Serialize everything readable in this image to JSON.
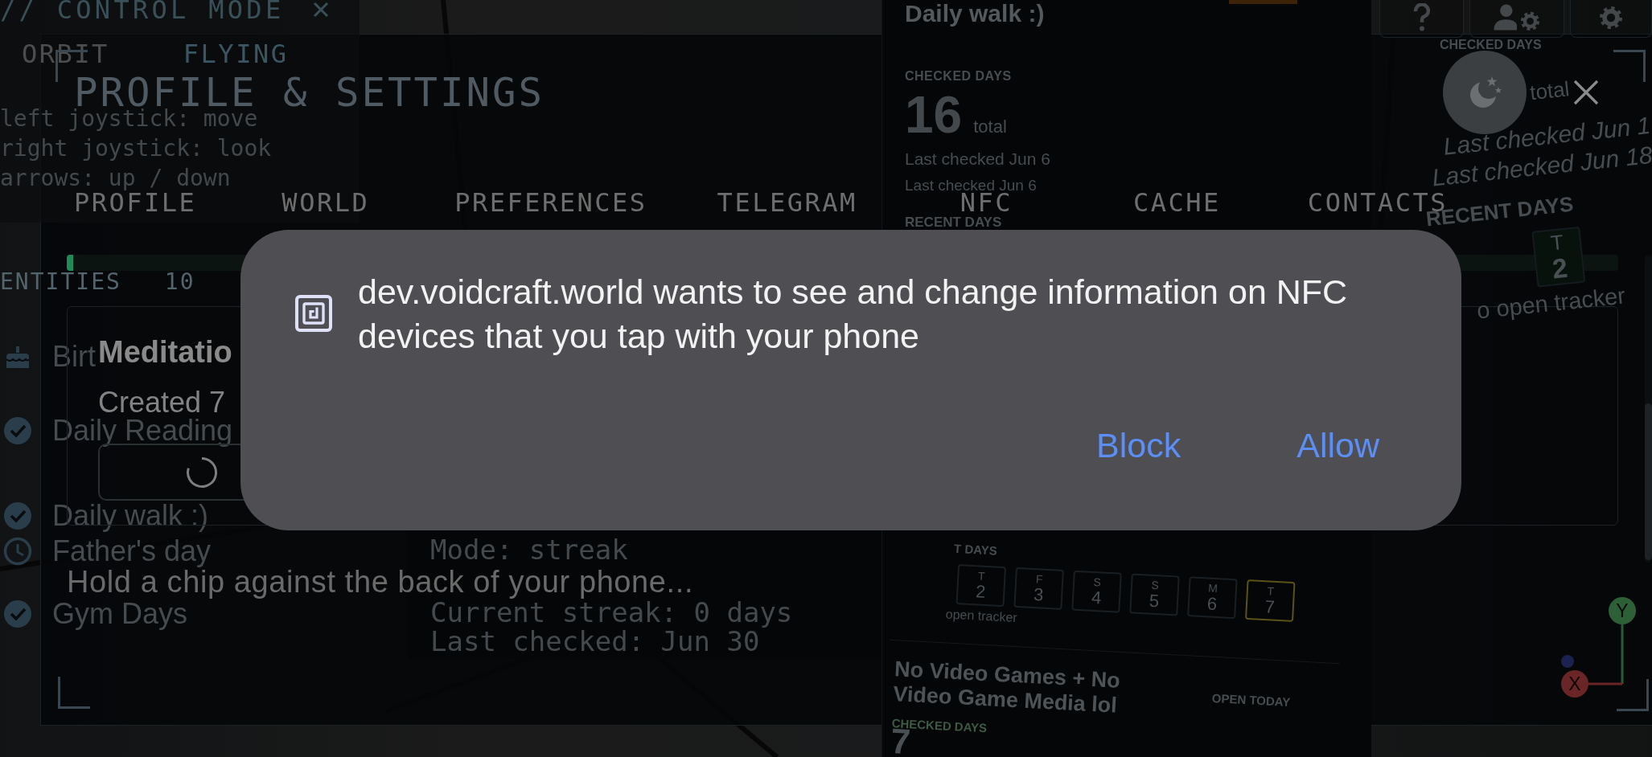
{
  "control_panel": {
    "title": "// CONTROL MODE",
    "modes": [
      {
        "label": "ORBIT",
        "selected": false
      },
      {
        "label": "FLYING",
        "selected": true
      }
    ],
    "hints": [
      "left joystick: move",
      "right joystick: look",
      "arrows: up / down"
    ],
    "entities_label": "ENTITIES",
    "entities_count": "10",
    "entities": [
      {
        "label": "Birt",
        "kind": "cake"
      },
      {
        "label": "Daily Reading",
        "kind": "check"
      },
      {
        "label": "Daily walk :)",
        "kind": "check"
      },
      {
        "label": "Father's day",
        "kind": "clock"
      },
      {
        "label": "Gym Days",
        "kind": "check"
      }
    ]
  },
  "walk_card": {
    "title": "Daily walk :)",
    "checked_label": "CHECKED DAYS",
    "count": "16",
    "count_unit": "total",
    "last_checked": [
      "Last checked Jun 6",
      "Last checked Jun 6"
    ],
    "recent_label": "RECENT DAYS"
  },
  "side_card": {
    "checked_label": "CHECKED DAYS",
    "count_unit": "total",
    "last_checked": [
      "Last checked Jun 1",
      "Last checked Jun 18"
    ],
    "recent_label": "RECENT DAYS",
    "day": {
      "weekday": "T",
      "date": "2"
    },
    "hint": "o open tracker"
  },
  "streak_card": {
    "lines": [
      "Mode: streak",
      "Current streak: 0 days",
      "Last checked: Jun 30"
    ]
  },
  "games_card": {
    "recent_label": "T DAYS",
    "days": [
      {
        "weekday": "T",
        "date": "2",
        "today": false
      },
      {
        "weekday": "F",
        "date": "3",
        "today": false
      },
      {
        "weekday": "S",
        "date": "4",
        "today": false
      },
      {
        "weekday": "S",
        "date": "5",
        "today": false
      },
      {
        "weekday": "M",
        "date": "6",
        "today": false
      },
      {
        "weekday": "T",
        "date": "7",
        "today": true
      }
    ],
    "hint": "open tracker",
    "title": "No Video Games + No Video Game Media lol",
    "action": "OPEN TODAY",
    "checked_label": "CHECKED DAYS",
    "count": "7"
  },
  "axis_gizmo": {
    "y_label": "Y",
    "x_label": "X"
  },
  "modal": {
    "title": "PROFILE & SETTINGS",
    "tabs": [
      "PROFILE",
      "WORLD",
      "PREFERENCES",
      "TELEGRAM",
      "NFC",
      "CACHE",
      "CONTACTS"
    ],
    "progress": {
      "level": 0.004
    },
    "entry": {
      "title": "Meditatio",
      "subtitle": "Created 7"
    },
    "status": "Hold a chip against the back of your phone..."
  },
  "nfc_dialog": {
    "message": "dev.voidcraft.world wants to see and change information on NFC devices that you tap with your phone",
    "buttons": [
      "Block",
      "Allow"
    ]
  }
}
